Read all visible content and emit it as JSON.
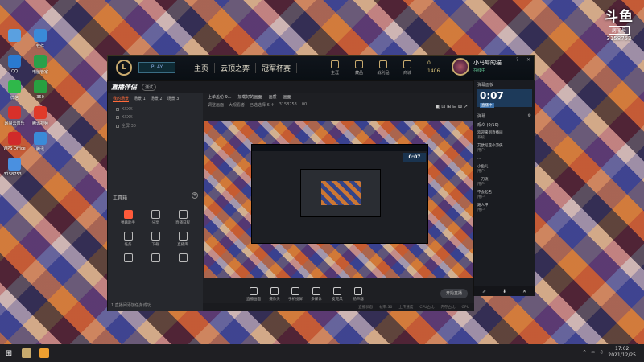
{
  "desktop": {
    "icons": [
      {
        "label": "",
        "color": "#5aa0e0"
      },
      {
        "label": "软件",
        "color": "#3a8ad8"
      },
      {
        "label": "QQ",
        "color": "#2a7ad0"
      },
      {
        "label": "电脑管家",
        "color": "#2aa14a"
      },
      {
        "label": "微信",
        "color": "#2fb84a"
      },
      {
        "label": "360",
        "color": "#28a040"
      },
      {
        "label": "网易云音乐",
        "color": "#d8302a"
      },
      {
        "label": "腾讯视频",
        "color": "#e03a2a"
      },
      {
        "label": "WPS Office",
        "color": "#d02a2a"
      },
      {
        "label": "腾讯",
        "color": "#3a8ad8"
      },
      {
        "label": "3158753...",
        "color": "#4a90e0"
      }
    ]
  },
  "brand": {
    "logo": "斗鱼",
    "tag": "房间号",
    "room": "3158753"
  },
  "lol": {
    "logo": "L",
    "play": "PLAY",
    "nav": [
      "主页",
      "云顶之弈",
      "冠军杯赛"
    ],
    "icons": [
      "生涯",
      "藏品",
      "战利品",
      "商城"
    ],
    "currency": [
      "0",
      "1406"
    ],
    "profile_name": "小马犀的猫",
    "profile_status": "在线中",
    "window_buttons": "? — ✕"
  },
  "app": {
    "title": "直播伴侣",
    "version": "测试",
    "scene_tabs": [
      "我的场景",
      "场景 1",
      "场景 2",
      "场景 3"
    ],
    "sources": [
      "XXXX",
      "XXXX",
      "全屏 30"
    ],
    "tools_title": "工具箱",
    "tools": [
      {
        "label": "弹幕助手",
        "hot": true
      },
      {
        "label": "分享",
        "hot": false
      },
      {
        "label": "直播日程",
        "hot": false
      },
      {
        "label": "任务",
        "hot": false
      },
      {
        "label": "下载",
        "hot": false
      },
      {
        "label": "直播库",
        "hot": false
      },
      {
        "label": "",
        "hot": false
      },
      {
        "label": "",
        "hot": false
      },
      {
        "label": "",
        "hot": false
      }
    ],
    "notice": "1 直播间添加任务成功",
    "preview_bar1": [
      "上单盖伦 9...",
      "加载好的画面",
      "画质",
      "画面"
    ],
    "preview_bar2": [
      "调整画面",
      "大观看者",
      "已选选择 6 ↑",
      "3158753",
      "00"
    ],
    "preview_icons": "▣ ⊡ ⊞ ⊟ ⊠ ↗",
    "nested_clock": "0:07",
    "controls": [
      "直播画面",
      "摄像头",
      "手机投屏",
      "多媒体",
      "麦克风",
      "扬声器"
    ],
    "start_label": "开始直播",
    "status": [
      "直播状态",
      "帧率:30",
      "上传速度",
      "CPU占比",
      "内存占比",
      "GPU"
    ]
  },
  "chat": {
    "title": "弹幕面板",
    "clock": "0:07",
    "clock_badge": "直播中",
    "header": "弹幕",
    "count": "观众 (0/10)",
    "messages": [
      {
        "text": "欢迎来到直播间",
        "user": "系统"
      },
      {
        "text": "艾欧尼亚小游侠",
        "user": "用户"
      },
      {
        "text": "...",
        "user": ""
      },
      {
        "text": "小鱼儿",
        "user": "用户"
      },
      {
        "text": "一刀流",
        "user": "用户"
      },
      {
        "text": "不会起名",
        "user": "用户"
      },
      {
        "text": "路人甲",
        "user": "用户"
      }
    ],
    "footer": [
      "⇗",
      "⬇",
      "✕"
    ]
  },
  "taskbar": {
    "start": "⊞",
    "apps": [
      "#c8aa6e",
      "#f0a030"
    ],
    "tray_icons": [
      "^",
      "▭",
      "♫"
    ],
    "time": "17:02",
    "date": "2021/12/25"
  }
}
